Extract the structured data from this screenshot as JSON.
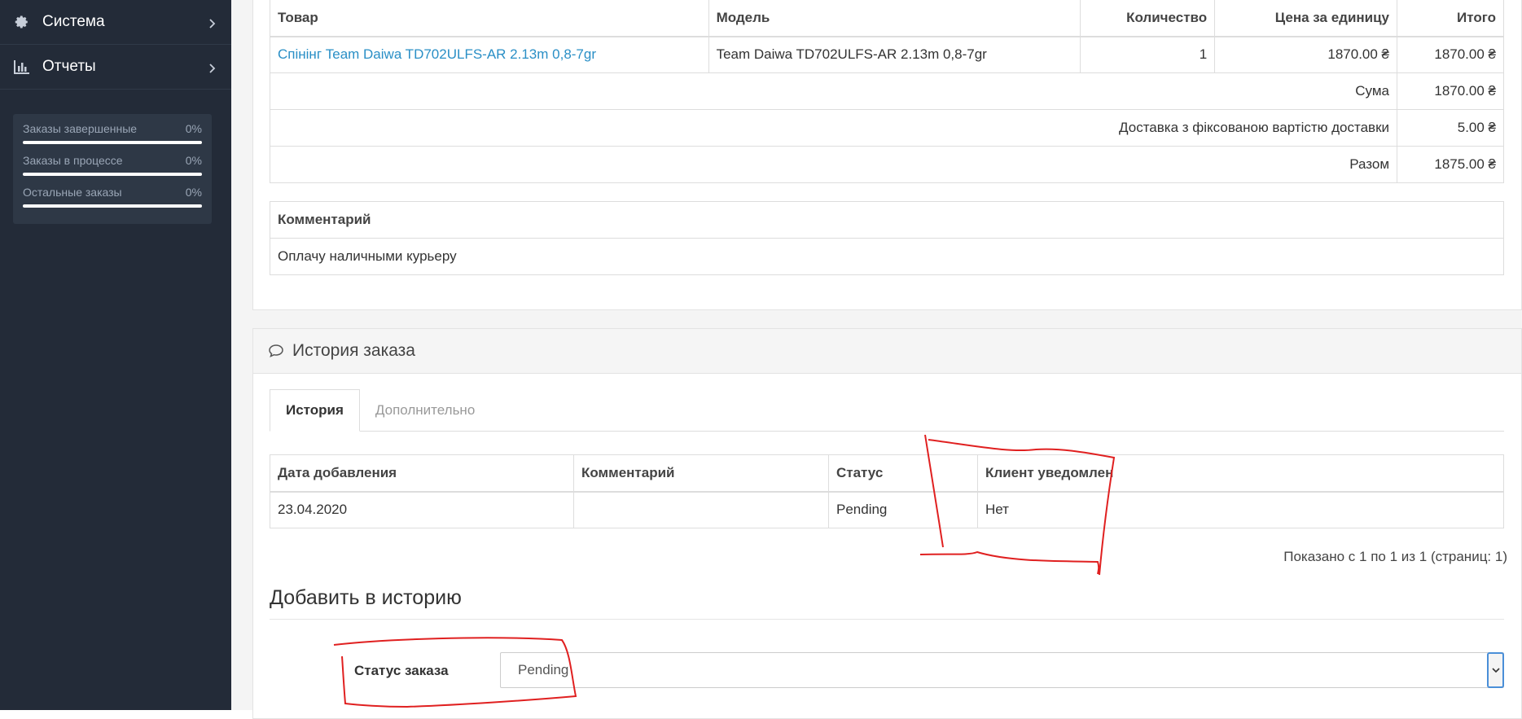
{
  "sidebar": {
    "items": [
      {
        "label": "Система",
        "icon": "gear-icon"
      },
      {
        "label": "Отчеты",
        "icon": "bar-chart-icon"
      }
    ],
    "stats": [
      {
        "label": "Заказы завершенные",
        "value": "0%",
        "progress": 0
      },
      {
        "label": "Заказы в процессе",
        "value": "0%",
        "progress": 0
      },
      {
        "label": "Остальные заказы",
        "value": "0%",
        "progress": 0
      }
    ]
  },
  "products": {
    "headers": [
      "Товар",
      "Модель",
      "Количество",
      "Цена за единицу",
      "Итого"
    ],
    "row": {
      "product": "Спінінг Team Daiwa TD702ULFS-AR 2.13m 0,8-7gr",
      "model": "Team Daiwa TD702ULFS-AR 2.13m 0,8-7gr",
      "quantity": "1",
      "unit_price": "1870.00 ₴",
      "total": "1870.00 ₴"
    },
    "totals": [
      {
        "label": "Сума",
        "value": "1870.00 ₴"
      },
      {
        "label": "Доставка з фіксованою вартістю доставки",
        "value": "5.00 ₴"
      },
      {
        "label": "Разом",
        "value": "1875.00 ₴"
      }
    ]
  },
  "comment": {
    "header": "Комментарий",
    "text": "Оплачу наличными курьеру"
  },
  "history": {
    "title": "История заказа",
    "tabs": [
      "История",
      "Дополнительно"
    ],
    "headers": [
      "Дата добавления",
      "Комментарий",
      "Статус",
      "Клиент уведомлен"
    ],
    "row": {
      "date": "23.04.2020",
      "comment": "",
      "status": "Pending",
      "notified": "Нет"
    },
    "pager": "Показано с 1 по 1 из 1 (страниц: 1)",
    "add_title": "Добавить в историю",
    "status_label": "Статус заказа",
    "status_value": "Pending"
  },
  "colors": {
    "sidebar_bg": "#232b38",
    "link": "#2a8fc6",
    "annotation": "#e02020"
  }
}
